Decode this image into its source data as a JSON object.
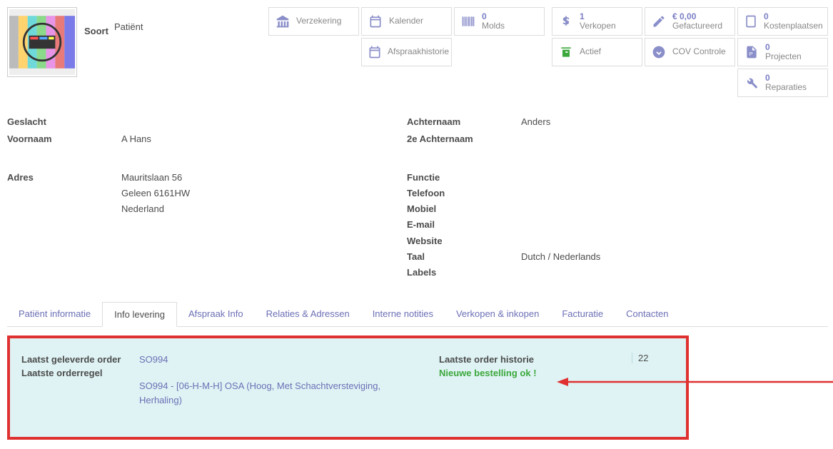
{
  "soort": {
    "label": "Soort",
    "value": "Patiënt"
  },
  "stat": {
    "verzekering": "Verzekering",
    "kalender": "Kalender",
    "molds": {
      "count": "0",
      "label": "Molds"
    },
    "verkopen": {
      "count": "1",
      "label": "Verkopen"
    },
    "gefactureerd": {
      "amount": "€ 0,00",
      "label": "Gefactureerd"
    },
    "kosten": {
      "count": "0",
      "label": "Kostenplaatsen"
    },
    "afspraak": "Afspraakhistorie",
    "actief": "Actief",
    "cov": "COV Controle",
    "projecten": {
      "count": "0",
      "label": "Projecten"
    },
    "reparaties": {
      "count": "0",
      "label": "Reparaties"
    }
  },
  "left": {
    "geslacht": "Geslacht",
    "voornaam": "Voornaam",
    "voornaam_val": "A  Hans",
    "adres": "Adres",
    "addr1": "Mauritslaan 56",
    "addr2": "Geleen  6161HW",
    "addr3": "Nederland"
  },
  "mid": {
    "achternaam": "Achternaam",
    "achternaam2": "2e Achternaam",
    "functie": "Functie",
    "telefoon": "Telefoon",
    "mobiel": "Mobiel",
    "email": "E-mail",
    "website": "Website",
    "taal": "Taal",
    "labels": "Labels"
  },
  "right": {
    "achternaam_val": "Anders",
    "taal_val": "Dutch / Nederlands"
  },
  "tabs": {
    "t1": "Patiënt informatie",
    "t2": "Info levering",
    "t3": "Afspraak Info",
    "t4": "Relaties & Adressen",
    "t5": "Interne notities",
    "t6": "Verkopen & inkopen",
    "t7": "Facturatie",
    "t8": "Contacten"
  },
  "highlight": {
    "l1": "Laatst geleverde order",
    "v1": "SO994",
    "l2": "Laatste orderregel",
    "v2": "SO994 - [06-H-M-H] OSA (Hoog, Met Schachtversteviging, Herhaling)",
    "l3": "Laatste order historie",
    "v3": "22",
    "msg": "Nieuwe bestelling ok !"
  }
}
